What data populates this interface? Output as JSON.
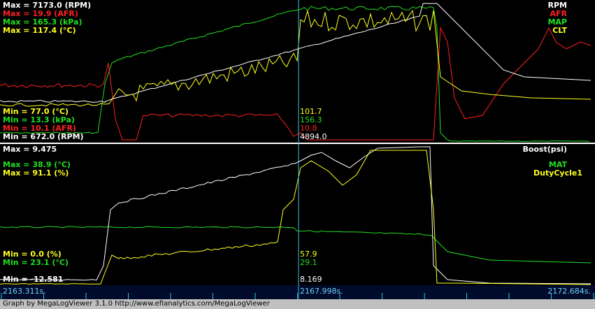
{
  "colors": {
    "rpm": "#ffffff",
    "afr": "#ff2020",
    "map": "#20e020",
    "clt": "#ffff20",
    "boost": "#ffffff",
    "mat": "#20e020",
    "duty": "#ffff20",
    "cursor": "#40c0e0",
    "divider": "#ffffff",
    "timebar": "#000a2a"
  },
  "top_panel": {
    "max_labels": [
      "Max = 7173.0 (RPM)",
      "Max = 19.9 (AFR)",
      "Max = 165.3 (kPa)",
      "Max = 117.4 (°C)"
    ],
    "min_labels": [
      "Min = 77.0 (°C)",
      "Min = 13.3 (kPa)",
      "Min = 10.1 (AFR)",
      "Min = 672.0 (RPM)"
    ],
    "legend": [
      "RPM",
      "AFR",
      "MAP",
      "CLT"
    ],
    "cursor_values": [
      "101.7",
      "156.3",
      "10.8",
      "4894.0"
    ]
  },
  "bottom_panel": {
    "max_labels": [
      "Max = 9.475",
      "Max = 38.9 (°C)",
      "Max = 91.1 (%)"
    ],
    "min_labels": [
      "Min = 0.0 (%)",
      "Min = 23.1 (°C)",
      "Min = -12.581"
    ],
    "legend": [
      "Boost(psi)",
      "MAT",
      "DutyCycle1"
    ],
    "cursor_values": [
      "57.9",
      "29.1",
      "8.169"
    ]
  },
  "timeline": {
    "start": "2163.311s.",
    "cursor": "2167.998s.",
    "end": "2172.684s."
  },
  "footer": "Graph by MegaLogViewer 3.1.0 http://www.efianalytics.com/MegaLogViewer"
}
